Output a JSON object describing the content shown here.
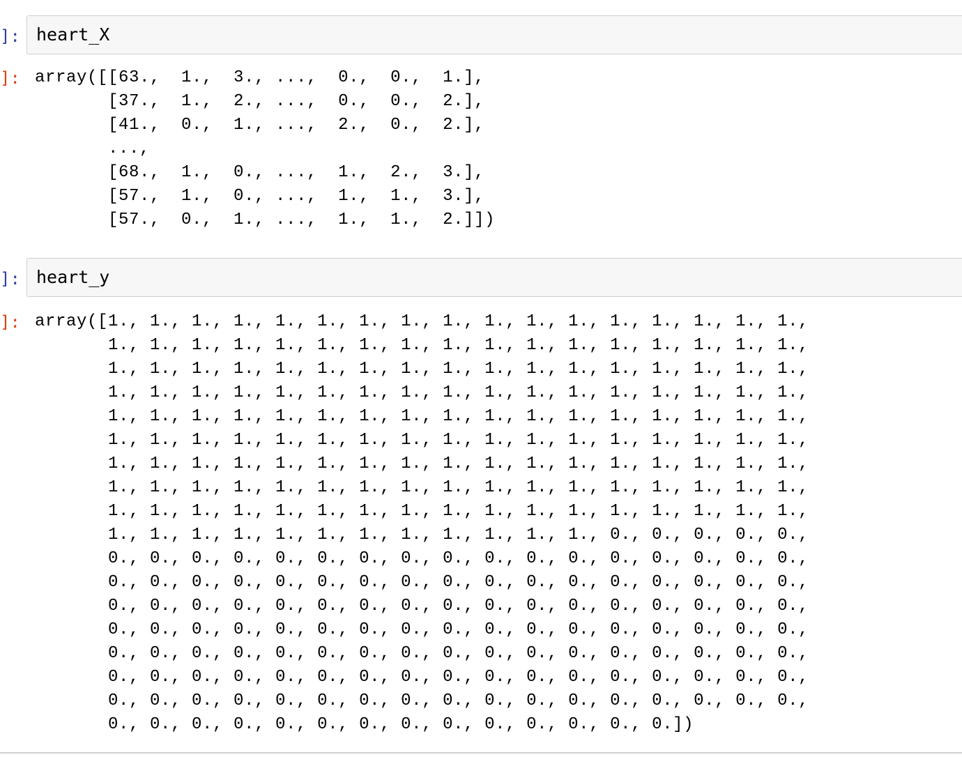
{
  "cells": [
    {
      "in_prompt": "]:",
      "code": "heart_X",
      "out_prompt": "]:",
      "output": "array([[63.,  1.,  3., ...,  0.,  0.,  1.],\n       [37.,  1.,  2., ...,  0.,  0.,  2.],\n       [41.,  0.,  1., ...,  2.,  0.,  2.],\n       ...,\n       [68.,  1.,  0., ...,  1.,  2.,  3.],\n       [57.,  1.,  0., ...,  1.,  1.,  3.],\n       [57.,  0.,  1., ...,  1.,  1.,  2.]])"
    },
    {
      "in_prompt": "]:",
      "code": "heart_y",
      "out_prompt": "]:",
      "output": "array([1., 1., 1., 1., 1., 1., 1., 1., 1., 1., 1., 1., 1., 1., 1., 1., 1.,\n       1., 1., 1., 1., 1., 1., 1., 1., 1., 1., 1., 1., 1., 1., 1., 1., 1.,\n       1., 1., 1., 1., 1., 1., 1., 1., 1., 1., 1., 1., 1., 1., 1., 1., 1.,\n       1., 1., 1., 1., 1., 1., 1., 1., 1., 1., 1., 1., 1., 1., 1., 1., 1.,\n       1., 1., 1., 1., 1., 1., 1., 1., 1., 1., 1., 1., 1., 1., 1., 1., 1.,\n       1., 1., 1., 1., 1., 1., 1., 1., 1., 1., 1., 1., 1., 1., 1., 1., 1.,\n       1., 1., 1., 1., 1., 1., 1., 1., 1., 1., 1., 1., 1., 1., 1., 1., 1.,\n       1., 1., 1., 1., 1., 1., 1., 1., 1., 1., 1., 1., 1., 1., 1., 1., 1.,\n       1., 1., 1., 1., 1., 1., 1., 1., 1., 1., 1., 1., 1., 1., 1., 1., 1.,\n       1., 1., 1., 1., 1., 1., 1., 1., 1., 1., 1., 1., 0., 0., 0., 0., 0.,\n       0., 0., 0., 0., 0., 0., 0., 0., 0., 0., 0., 0., 0., 0., 0., 0., 0.,\n       0., 0., 0., 0., 0., 0., 0., 0., 0., 0., 0., 0., 0., 0., 0., 0., 0.,\n       0., 0., 0., 0., 0., 0., 0., 0., 0., 0., 0., 0., 0., 0., 0., 0., 0.,\n       0., 0., 0., 0., 0., 0., 0., 0., 0., 0., 0., 0., 0., 0., 0., 0., 0.,\n       0., 0., 0., 0., 0., 0., 0., 0., 0., 0., 0., 0., 0., 0., 0., 0., 0.,\n       0., 0., 0., 0., 0., 0., 0., 0., 0., 0., 0., 0., 0., 0., 0., 0., 0.,\n       0., 0., 0., 0., 0., 0., 0., 0., 0., 0., 0., 0., 0., 0., 0., 0., 0.,\n       0., 0., 0., 0., 0., 0., 0., 0., 0., 0., 0., 0., 0., 0.])"
    }
  ]
}
